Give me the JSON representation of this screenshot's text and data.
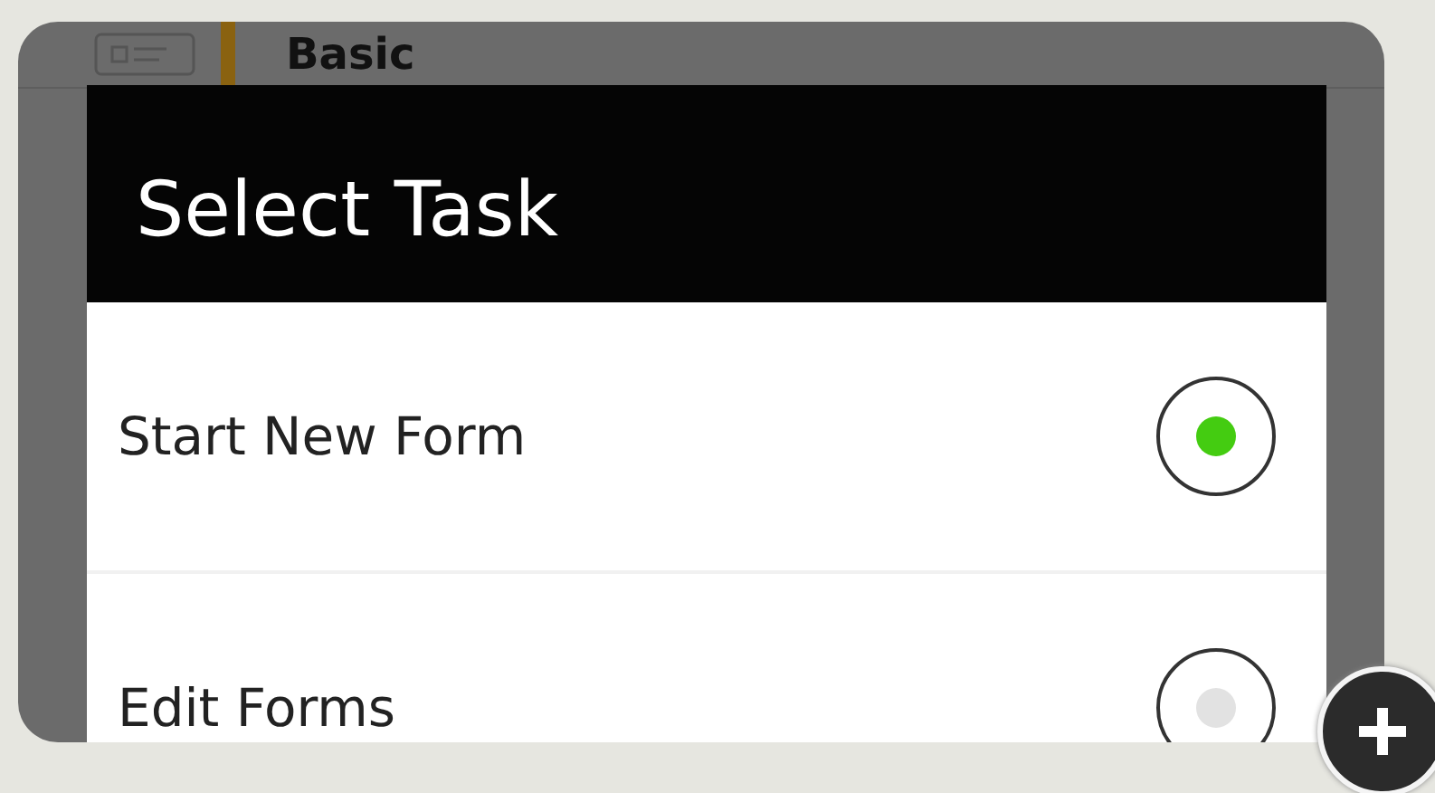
{
  "background_list": {
    "items": [
      {
        "text": "Basic",
        "kind": "title"
      }
    ]
  },
  "dialog": {
    "title": "Select Task",
    "options": [
      {
        "label": "Start New Form",
        "selected": true
      },
      {
        "label": "Edit Forms",
        "selected": false
      }
    ]
  }
}
